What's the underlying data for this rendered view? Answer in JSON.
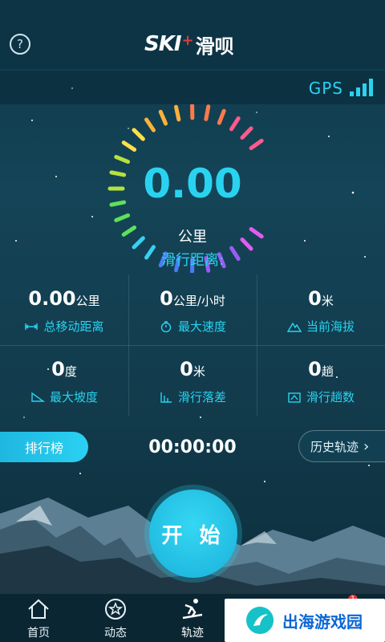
{
  "header": {
    "help_icon": "?",
    "logo_ski": "SKI",
    "logo_plus": "+",
    "logo_cn": "滑呗"
  },
  "gps": {
    "label": "GPS",
    "signal_icon": "signal-bars-icon"
  },
  "gauge": {
    "value": "0.00",
    "unit": "公里",
    "label": "滑行距离:",
    "colors": [
      "#ff5a8c",
      "#ff7a4a",
      "#ffb13b",
      "#ffe04a",
      "#b6e23c",
      "#5fe05a",
      "#3ad0f0",
      "#4a7cf5",
      "#9b5cf5",
      "#e25cf0"
    ]
  },
  "stats": [
    {
      "value": "0.00",
      "unit": "公里",
      "label": "总移动距离",
      "icon": "distance-icon"
    },
    {
      "value": "0",
      "unit": "公里/小时",
      "label": "最大速度",
      "icon": "stopwatch-icon"
    },
    {
      "value": "0",
      "unit": "米",
      "label": "当前海拔",
      "icon": "altitude-icon"
    },
    {
      "value": "0",
      "unit": "度",
      "label": "最大坡度",
      "icon": "slope-icon"
    },
    {
      "value": "0",
      "unit": "米",
      "label": "滑行落差",
      "icon": "drop-icon"
    },
    {
      "value": "0",
      "unit": "趟",
      "label": "滑行趟数",
      "icon": "runs-icon"
    }
  ],
  "rank_label": "排行榜",
  "timer": "00:00:00",
  "history_label": "历史轨迹",
  "history_chevron": "›",
  "start_label": "开 始",
  "tabs": [
    {
      "label": "首页",
      "icon": "home-icon"
    },
    {
      "label": "动态",
      "icon": "star-feed-icon"
    },
    {
      "label": "轨迹",
      "icon": "skier-icon",
      "active": true
    }
  ],
  "badge_count": "1",
  "watermark": "出海游戏园"
}
